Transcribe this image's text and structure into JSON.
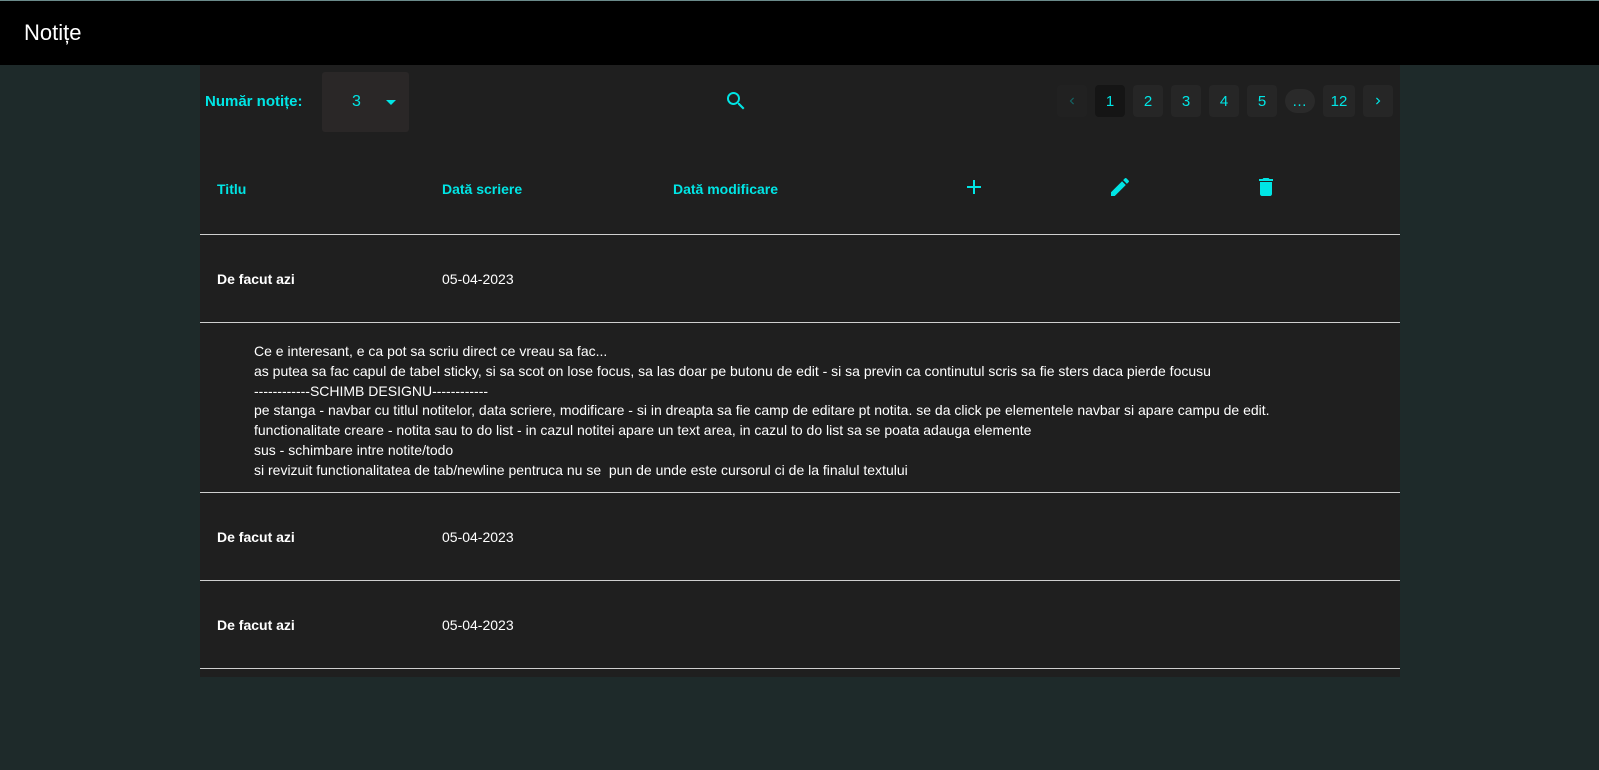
{
  "app": {
    "title": "Notițe"
  },
  "toolbar": {
    "count_label": "Număr notițe:",
    "count_value": "3",
    "search_icon": "search-icon"
  },
  "pagination": {
    "pages": [
      "1",
      "2",
      "3",
      "4",
      "5",
      "…",
      "12"
    ],
    "current": "1"
  },
  "table": {
    "headers": {
      "title": "Titlu",
      "written": "Dată scriere",
      "modified": "Dată modificare"
    },
    "actions": [
      "plus-icon",
      "pencil-icon",
      "trash-icon"
    ],
    "rows": [
      {
        "title": "De facut azi",
        "written": "05-04-2023",
        "modified": ""
      },
      {
        "title": "De facut azi",
        "written": "05-04-2023",
        "modified": ""
      },
      {
        "title": "De facut azi",
        "written": "05-04-2023",
        "modified": ""
      }
    ],
    "expanded_content": [
      "Ce e interesant, e ca pot sa scriu direct ce vreau sa fac...",
      "as putea sa fac capul de tabel sticky, si sa scot on lose focus, sa las doar pe butonu de edit - si sa previn ca continutul scris sa fie sters daca pierde focusu",
      "------------SCHIMB DESIGNU------------",
      "pe stanga - navbar cu titlul notitelor, data scriere, modificare - si in dreapta sa fie camp de editare pt notita. se da click pe elementele navbar si apare campu de edit.",
      "functionalitate creare - notita sau to do list - in cazul notitei apare un text area, in cazul to do list sa se poata adauga elemente",
      "sus - schimbare intre notite/todo",
      "si revizuit functionalitatea de tab/newline pentruca nu se  pun de unde este cursorul ci de la finalul textului"
    ]
  },
  "colors": {
    "accent": "#00e5e5",
    "panel": "#1f1f1f",
    "background": "#1e2a2a",
    "appbar": "#000000"
  }
}
